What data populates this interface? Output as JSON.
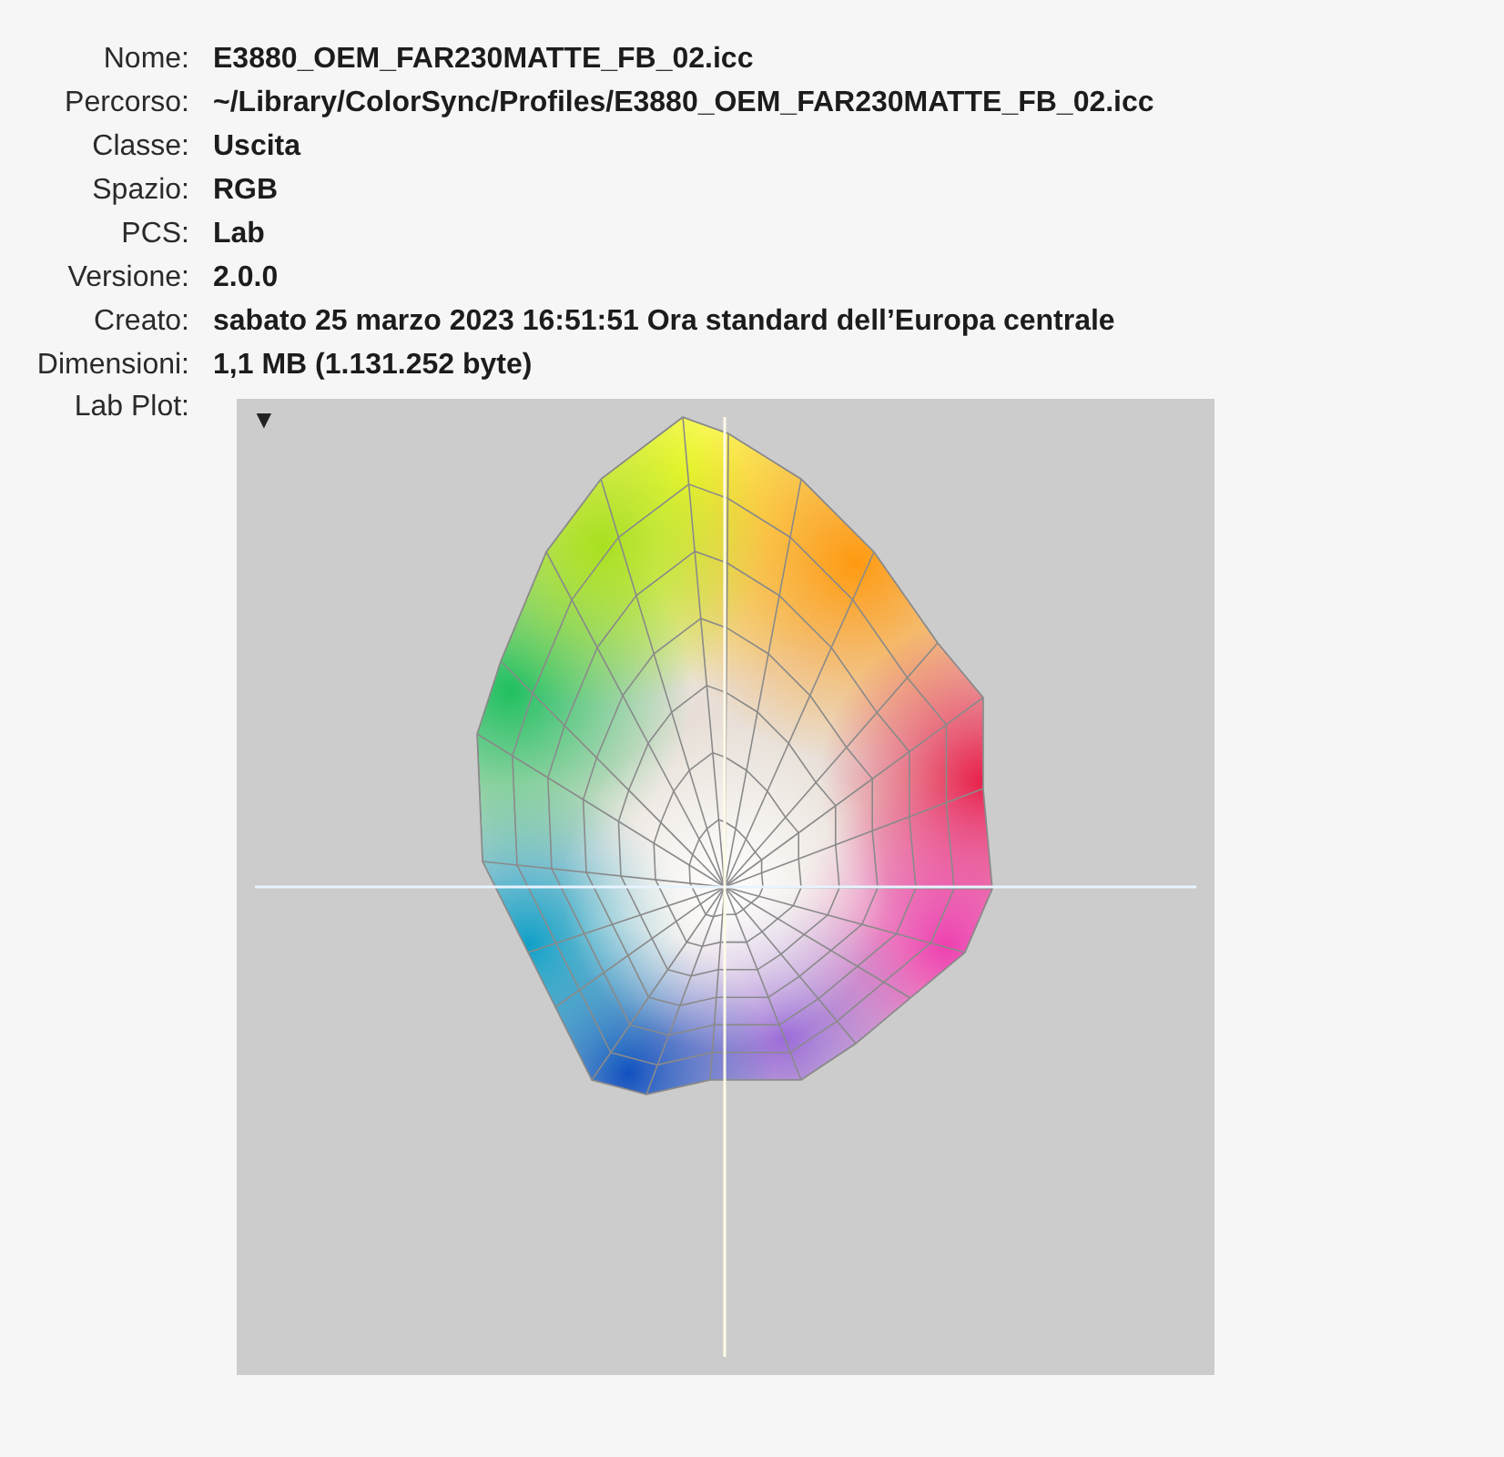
{
  "properties": [
    {
      "label": "Nome:",
      "value": "E3880_OEM_FAR230MATTE_FB_02.icc"
    },
    {
      "label": "Percorso:",
      "value": "~/Library/ColorSync/Profiles/E3880_OEM_FAR230MATTE_FB_02.icc"
    },
    {
      "label": "Classe:",
      "value": "Uscita"
    },
    {
      "label": "Spazio:",
      "value": "RGB"
    },
    {
      "label": "PCS:",
      "value": "Lab"
    },
    {
      "label": "Versione:",
      "value": "2.0.0"
    },
    {
      "label": "Creato:",
      "value": "sabato 25 marzo 2023 16:51:51 Ora standard dell’Europa centrale"
    },
    {
      "label": "Dimensioni:",
      "value": "1,1 MB (1.131.252 byte)"
    }
  ],
  "lab_plot": {
    "label": "Lab Plot:",
    "menu_glyph": "▼"
  }
}
